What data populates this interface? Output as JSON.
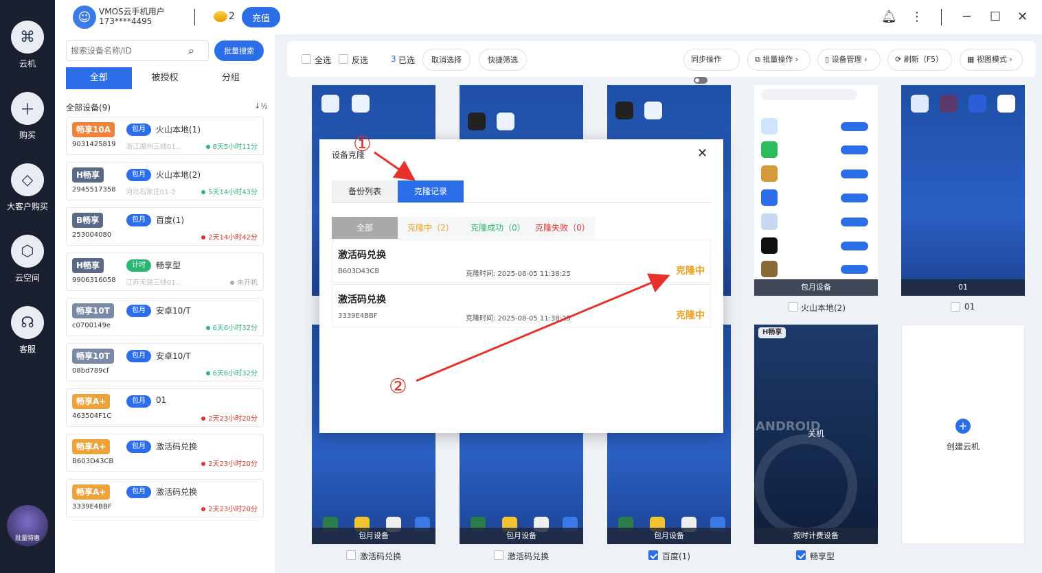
{
  "rail": {
    "items": [
      {
        "label": "云机",
        "icon": "cloud-phone-icon"
      },
      {
        "label": "购买",
        "icon": "plus-icon"
      },
      {
        "label": "大客户购买",
        "icon": "diamond-icon"
      },
      {
        "label": "云空间",
        "icon": "box-icon"
      },
      {
        "label": "客服",
        "icon": "headset-icon"
      }
    ],
    "promo_label": "批量特惠"
  },
  "topbar": {
    "user_name": "VMOS云手机用户",
    "user_phone": "173****4495",
    "coin_count": "2",
    "recharge_label": "充值"
  },
  "sidebar": {
    "search_placeholder": "搜索设备名称/ID",
    "batch_search_label": "批量搜索",
    "tabs": [
      "全部",
      "被授权",
      "分组"
    ],
    "all_devices_title": "全部设备(9)",
    "devices": [
      {
        "brand": "畅享10A",
        "type": "包月",
        "name": "火山本地(1)",
        "id": "9031425819",
        "loc": "浙江湖州三线01...",
        "time": "8天5小时11分",
        "status": "green"
      },
      {
        "brand": "H畅享",
        "type": "包月",
        "name": "火山本地(2)",
        "id": "2945517358",
        "loc": "河北石家庄01-2",
        "time": "5天14小时43分",
        "status": "green"
      },
      {
        "brand": "B畅享",
        "type": "包月",
        "name": "百度(1)",
        "id": "253004080",
        "loc": "",
        "time": "2天14小时42分",
        "status": "red"
      },
      {
        "brand": "H畅享",
        "type": "计时",
        "name": "畅享型",
        "id": "9906316058",
        "loc": "江苏无锡三线01...",
        "time": "未开机",
        "status": "gray"
      },
      {
        "brand": "畅享10T",
        "type": "包月",
        "name": "安卓10/T",
        "id": "c0700149e",
        "loc": "",
        "time": "6天6小时32分",
        "status": "green"
      },
      {
        "brand": "畅享10T",
        "type": "包月",
        "name": "安卓10/T",
        "id": "08bd789cf",
        "loc": "",
        "time": "6天6小时32分",
        "status": "green"
      },
      {
        "brand": "畅享A+",
        "type": "包月",
        "name": "01",
        "id": "463504F1C",
        "loc": "",
        "time": "2天23小时20分",
        "status": "red"
      },
      {
        "brand": "畅享A+",
        "type": "包月",
        "name": "激活码兑换",
        "id": "B603D43CB",
        "loc": "",
        "time": "2天23小时20分",
        "status": "red"
      },
      {
        "brand": "畅享A+",
        "type": "包月",
        "name": "激活码兑换",
        "id": "3339E4BBF",
        "loc": "",
        "time": "2天23小时20分",
        "status": "red"
      }
    ]
  },
  "toolbar": {
    "select_all": "全选",
    "invert": "反选",
    "selected_count": "3",
    "selected_suffix": "已选",
    "cancel_select": "取消选择",
    "quick_filter": "快捷筛选",
    "sync_op": "同步操作",
    "batch_op": "批量操作",
    "device_mgmt": "设备管理",
    "refresh": "刷新（F5）",
    "view_mode": "视图模式"
  },
  "grid": {
    "row1_labels": [
      "包月设备",
      "01"
    ],
    "row1_names": [
      "火山本地(2)",
      "01"
    ],
    "row2_labels": [
      "包月设备",
      "包月设备",
      "包月设备",
      "按时计费设备"
    ],
    "row2_names": [
      "激活码兑换",
      "激活码兑换",
      "百度(1)",
      "畅享型"
    ],
    "off_label": "关机",
    "off_brand": "H畅享",
    "android_text": "ANDROID",
    "create_label": "创建云机"
  },
  "modal": {
    "title": "设备克隆",
    "tabs": [
      "备份列表",
      "克隆记录"
    ],
    "filters": [
      "全部",
      "克隆中（2）",
      "克隆成功（0）",
      "克隆失败（0）"
    ],
    "records": [
      {
        "title": "激活码兑换",
        "code": "B603D43CB",
        "time": "克隆时间: 2025-08-05 11:38:25",
        "status": "克隆中"
      },
      {
        "title": "激活码兑换",
        "code": "3339E4BBF",
        "time": "克隆时间: 2025-08-05 11:38:25",
        "status": "克隆中"
      }
    ]
  },
  "annotations": [
    "①",
    "②"
  ],
  "colors": {
    "accent": "#2b6ee8",
    "rail": "#1b2030",
    "warning": "#f0a020",
    "annotation": "#e8312a"
  }
}
